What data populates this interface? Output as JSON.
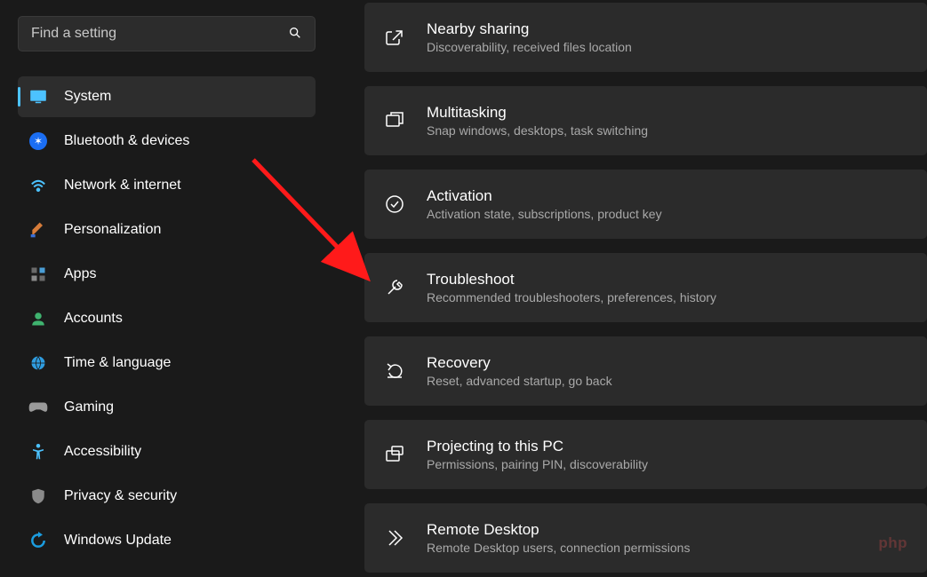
{
  "search": {
    "placeholder": "Find a setting"
  },
  "sidebar": {
    "items": [
      {
        "label": "System"
      },
      {
        "label": "Bluetooth & devices"
      },
      {
        "label": "Network & internet"
      },
      {
        "label": "Personalization"
      },
      {
        "label": "Apps"
      },
      {
        "label": "Accounts"
      },
      {
        "label": "Time & language"
      },
      {
        "label": "Gaming"
      },
      {
        "label": "Accessibility"
      },
      {
        "label": "Privacy & security"
      },
      {
        "label": "Windows Update"
      }
    ]
  },
  "main": {
    "cards": [
      {
        "title": "Nearby sharing",
        "sub": "Discoverability, received files location"
      },
      {
        "title": "Multitasking",
        "sub": "Snap windows, desktops, task switching"
      },
      {
        "title": "Activation",
        "sub": "Activation state, subscriptions, product key"
      },
      {
        "title": "Troubleshoot",
        "sub": "Recommended troubleshooters, preferences, history"
      },
      {
        "title": "Recovery",
        "sub": "Reset, advanced startup, go back"
      },
      {
        "title": "Projecting to this PC",
        "sub": "Permissions, pairing PIN, discoverability"
      },
      {
        "title": "Remote Desktop",
        "sub": "Remote Desktop users, connection permissions"
      }
    ]
  },
  "watermark": "php"
}
